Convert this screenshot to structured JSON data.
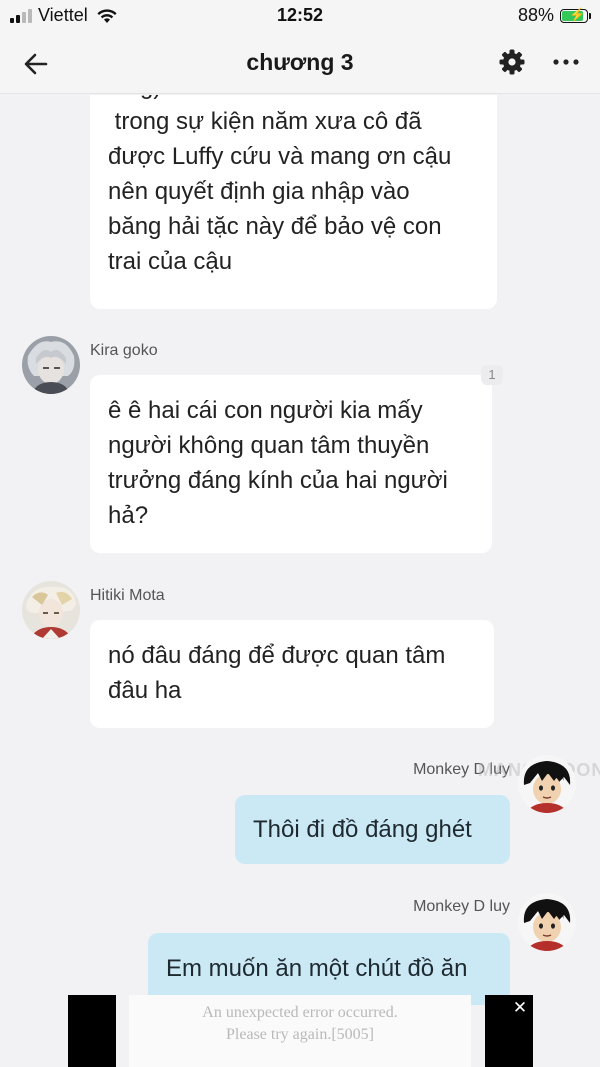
{
  "status_bar": {
    "carrier": "Viettel",
    "time": "12:52",
    "battery_percent": "88%",
    "battery_level": 0.88
  },
  "nav": {
    "title": "chương 3",
    "icons": [
      "back-arrow-icon",
      "gear-icon",
      "more-icon"
    ]
  },
  "messages": [
    {
      "direction": "in",
      "sender": "",
      "lines": [
        "lung)",
        " trong sự kiện năm xưa cô đã",
        "được Luffy cứu và mang ơn cậu",
        "nên quyết định gia nhập vào",
        "băng hải tặc này để bảo vệ con",
        "trai của cậu"
      ]
    },
    {
      "direction": "in",
      "sender": "Kira goko",
      "badge": "1",
      "lines": [
        "ê ê hai cái con người kia mấy",
        "người không quan tâm thuyền",
        "trưởng đáng kính của hai người",
        "hả?"
      ]
    },
    {
      "direction": "in",
      "sender": "Hitiki Mota",
      "lines": [
        "nó đâu đáng để được quan tâm",
        "đâu ha"
      ]
    },
    {
      "direction": "out",
      "sender": "Monkey D luy",
      "text": "Thôi đi đồ đáng ghét"
    },
    {
      "direction": "out",
      "sender": "Monkey D luy",
      "text": "Em muốn ăn một chút đồ ăn"
    }
  ],
  "watermark": "MANGATOON",
  "ad": {
    "error_line1": "An unexpected error occurred.",
    "error_line2": "Please try again.[5005]",
    "close": "✕"
  },
  "colors": {
    "background": "#f2f2f4",
    "incoming_bubble": "#ffffff",
    "outgoing_bubble": "#cbe8f5"
  }
}
